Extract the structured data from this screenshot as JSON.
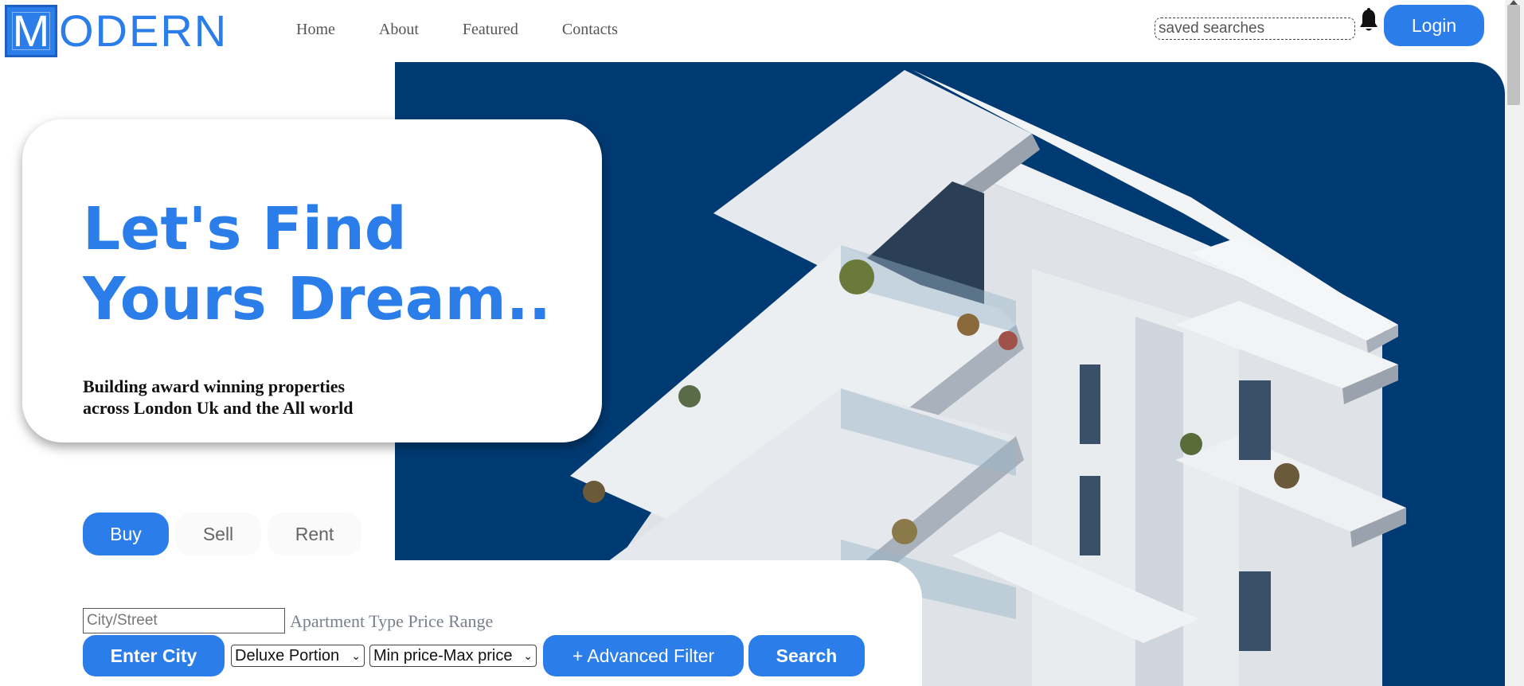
{
  "header": {
    "logo_letter": "M",
    "logo_text": "ODERN",
    "nav": [
      {
        "label": "Home"
      },
      {
        "label": "About"
      },
      {
        "label": "Featured"
      },
      {
        "label": "Contacts"
      }
    ],
    "saved_searches_placeholder": "saved searches",
    "bell_icon": "bell-icon",
    "login_label": "Login"
  },
  "hero": {
    "headline_line1": "Let's Find",
    "headline_line2": "Yours Dream..",
    "sub_line1": "Building award winning properties",
    "sub_line2": "across London Uk and the All world",
    "image_desc": "modern-apartment-building"
  },
  "tabs": [
    {
      "label": "Buy"
    },
    {
      "label": "Sell"
    },
    {
      "label": "Rent"
    }
  ],
  "search": {
    "city_placeholder": "City/Street",
    "apartment_type_label": "Apartment Type",
    "price_range_label": "Price Range",
    "enter_city_label": "Enter City",
    "apartment_select_value": "Deluxe Portion",
    "price_select_value": "Min price-Max price",
    "advanced_filter_label": "+ Advanced Filter",
    "search_label": "Search"
  },
  "colors": {
    "accent": "#2b7de9",
    "hero_bg": "#003a73"
  }
}
